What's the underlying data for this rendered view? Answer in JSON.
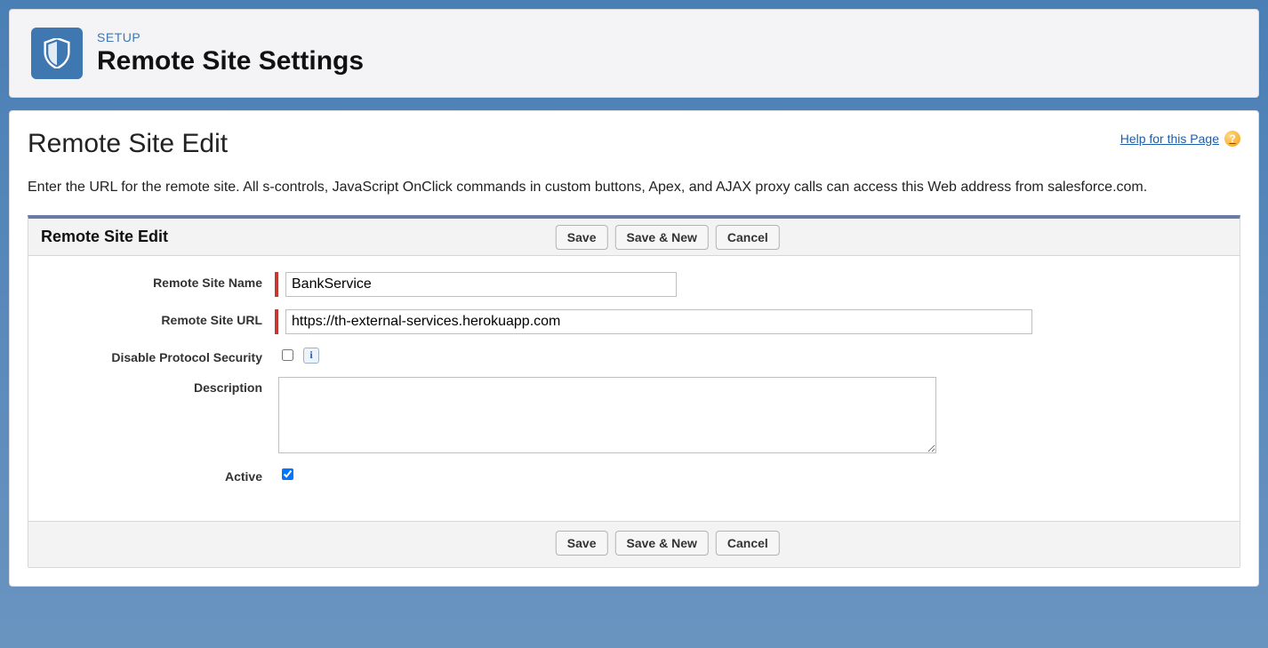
{
  "header": {
    "kicker": "SETUP",
    "title": "Remote Site Settings"
  },
  "page": {
    "title": "Remote Site Edit",
    "help_label": "Help for this Page",
    "intro": "Enter the URL for the remote site. All s-controls, JavaScript OnClick commands in custom buttons, Apex, and AJAX proxy calls can access this Web address from salesforce.com."
  },
  "panel": {
    "section_title": "Remote Site Edit",
    "buttons": {
      "save": "Save",
      "save_new": "Save & New",
      "cancel": "Cancel"
    },
    "fields": {
      "name": {
        "label": "Remote Site Name",
        "value": "BankService"
      },
      "url": {
        "label": "Remote Site URL",
        "value": "https://th-external-services.herokuapp.com"
      },
      "dps": {
        "label": "Disable Protocol Security",
        "checked": false
      },
      "desc": {
        "label": "Description",
        "value": ""
      },
      "active": {
        "label": "Active",
        "checked": true
      }
    }
  }
}
